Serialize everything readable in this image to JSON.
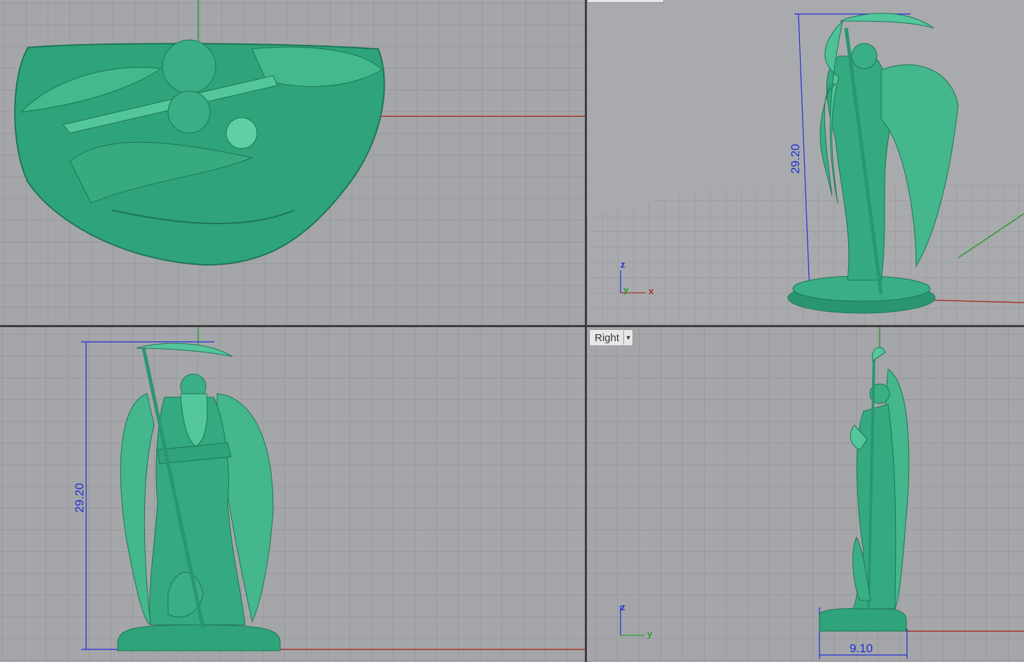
{
  "viewports": {
    "top": {
      "label": ""
    },
    "perspective": {
      "label": "",
      "dimension": "29.20",
      "axes": {
        "z": "z",
        "y": "y",
        "x": "x"
      }
    },
    "front": {
      "label": "",
      "dimension": "29.20"
    },
    "right": {
      "label": "Right",
      "dimension_height": "",
      "dimension_width": "9.10",
      "axes": {
        "z": "z",
        "y": "y"
      }
    }
  },
  "colors": {
    "model": "#2fa37a",
    "model_dark": "#1e7556",
    "model_light": "#5fd0a3",
    "grid": "#96989c",
    "background": "#a4a6a9",
    "axis_x": "#a8322c",
    "axis_y": "#2e9a2e",
    "dimension": "#1f2fd8"
  },
  "icons": {
    "dropdown": "chevron-down-icon"
  }
}
